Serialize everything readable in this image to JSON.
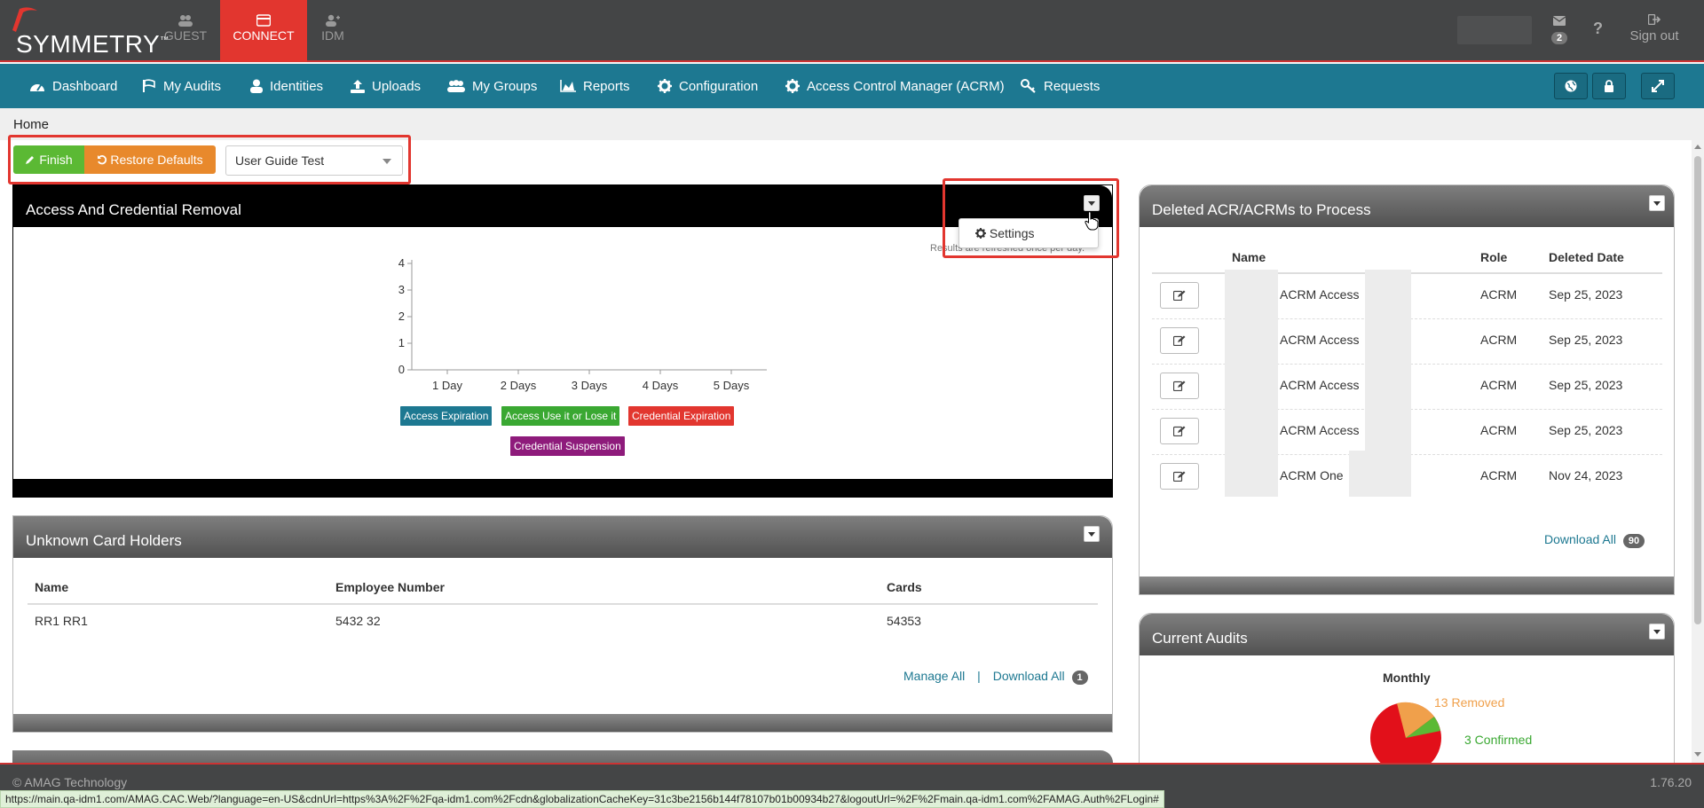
{
  "brand": {
    "logo_text": "SYMMETRY",
    "trademark": "™"
  },
  "app_tabs": [
    {
      "label": "GUEST",
      "active": false
    },
    {
      "label": "CONNECT",
      "active": true
    },
    {
      "label": "IDM",
      "active": false
    }
  ],
  "header": {
    "mail_count": "2",
    "help": "?",
    "signout": "Sign out"
  },
  "nav": {
    "items": [
      "Dashboard",
      "My Audits",
      "Identities",
      "Uploads",
      "My Groups",
      "Reports",
      "Configuration",
      "Access Control Manager (ACRM)",
      "Requests"
    ]
  },
  "breadcrumb": "Home",
  "toolbar": {
    "finish_label": "Finish",
    "restore_label": "Restore Defaults",
    "layout_value": "User Guide Test"
  },
  "access_widget": {
    "title": "Access And Credential Removal",
    "settings_label": "Settings",
    "refresh_note": "Results are refreshed once per day.",
    "legend": [
      {
        "label": "Access Expiration",
        "color": "#1d7891"
      },
      {
        "label": "Access Use it or Lose it",
        "color": "#3aa832"
      },
      {
        "label": "Credential Expiration",
        "color": "#e2362f"
      },
      {
        "label": "Credential Suspension",
        "color": "#8e1b7b"
      }
    ]
  },
  "chart_data": {
    "type": "bar",
    "categories": [
      "1 Day",
      "2 Days",
      "3 Days",
      "4 Days",
      "5 Days"
    ],
    "series": [
      {
        "name": "Access Expiration",
        "values": [
          0,
          0,
          0,
          0,
          0
        ]
      },
      {
        "name": "Access Use it or Lose it",
        "values": [
          0,
          0,
          0,
          0,
          0
        ]
      },
      {
        "name": "Credential Expiration",
        "values": [
          0,
          0,
          0,
          0,
          0
        ]
      },
      {
        "name": "Credential Suspension",
        "values": [
          0,
          0,
          0,
          0,
          0
        ]
      }
    ],
    "yticks": [
      "0",
      "1",
      "2",
      "3",
      "4"
    ],
    "ylim": [
      0,
      4
    ],
    "legend_position": "bottom"
  },
  "unknown_widget": {
    "title": "Unknown Card Holders",
    "columns": [
      "Name",
      "Employee Number",
      "Cards"
    ],
    "rows": [
      {
        "name": "RR1 RR1",
        "employee_number": "5432 32",
        "cards": "54353"
      }
    ],
    "manage_all": "Manage All",
    "separator": "|",
    "download_all": "Download All",
    "download_count": "1"
  },
  "deleted_widget": {
    "title": "Deleted ACR/ACRMs to Process",
    "columns": [
      "Name",
      "Role",
      "Deleted Date"
    ],
    "rows": [
      {
        "name": "ACRM Access",
        "role": "ACRM",
        "date": "Sep 25, 2023"
      },
      {
        "name": "ACRM Access",
        "role": "ACRM",
        "date": "Sep 25, 2023"
      },
      {
        "name": "ACRM Access",
        "role": "ACRM",
        "date": "Sep 25, 2023"
      },
      {
        "name": "ACRM Access",
        "role": "ACRM",
        "date": "Sep 25, 2023"
      },
      {
        "name": "ACRM One",
        "role": "ACRM",
        "date": "Nov 24, 2023"
      }
    ],
    "download_all": "Download All",
    "download_count": "90"
  },
  "audits_widget": {
    "title": "Current Audits",
    "subtitle": "Monthly",
    "removed_label": "13 Removed",
    "confirmed_label": "3 Confirmed",
    "colors": {
      "removed": "#f0a04b",
      "confirmed": "#5bb934",
      "other": "#e2101a"
    }
  },
  "footer": {
    "copyright": "© AMAG Technology",
    "version": "1.76.20",
    "status_url": "https://main.qa-idm1.com/AMAG.CAC.Web/?language=en-US&cdnUrl=https%3A%2F%2Fqa-idm1.com%2Fcdn&globalizationCacheKey=31c3be2156b144f78107b01b00934b27&logoutUrl=%2F%2Fmain.qa-idm1.com%2FAMAG.Auth%2FLogin#"
  }
}
